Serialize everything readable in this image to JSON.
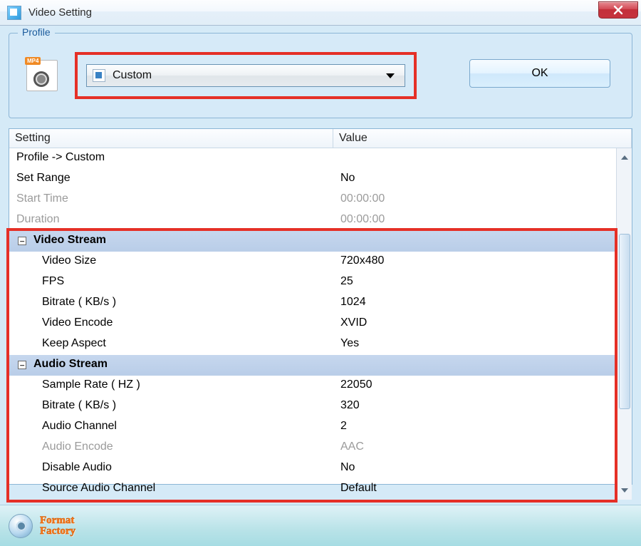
{
  "window": {
    "title": "Video Setting",
    "close_label": "Close"
  },
  "profile": {
    "legend": "Profile",
    "format_badge": "MP4",
    "selected": "Custom",
    "ok_label": "OK"
  },
  "table": {
    "col_setting": "Setting",
    "col_value": "Value",
    "rows": [
      {
        "label": "Profile -> Custom",
        "value": "",
        "type": "plain"
      },
      {
        "label": "Set Range",
        "value": "No",
        "type": "plain"
      },
      {
        "label": "Start Time",
        "value": "00:00:00",
        "type": "disabled"
      },
      {
        "label": "Duration",
        "value": "00:00:00",
        "type": "disabled"
      },
      {
        "label": "Video Stream",
        "value": "",
        "type": "group"
      },
      {
        "label": "Video Size",
        "value": "720x480",
        "type": "child"
      },
      {
        "label": "FPS",
        "value": "25",
        "type": "child"
      },
      {
        "label": "Bitrate ( KB/s )",
        "value": "1024",
        "type": "child"
      },
      {
        "label": "Video Encode",
        "value": "XVID",
        "type": "child"
      },
      {
        "label": "Keep Aspect",
        "value": "Yes",
        "type": "child"
      },
      {
        "label": "Audio Stream",
        "value": "",
        "type": "group"
      },
      {
        "label": "Sample Rate ( HZ )",
        "value": "22050",
        "type": "child"
      },
      {
        "label": "Bitrate ( KB/s )",
        "value": "320",
        "type": "child"
      },
      {
        "label": "Audio Channel",
        "value": "2",
        "type": "child"
      },
      {
        "label": "Audio Encode",
        "value": "AAC",
        "type": "child-disabled"
      },
      {
        "label": "Disable Audio",
        "value": "No",
        "type": "child"
      },
      {
        "label": "Source Audio Channel",
        "value": "Default",
        "type": "child"
      }
    ]
  },
  "footer": {
    "brand_line1": "Format",
    "brand_line2": "Factory"
  }
}
